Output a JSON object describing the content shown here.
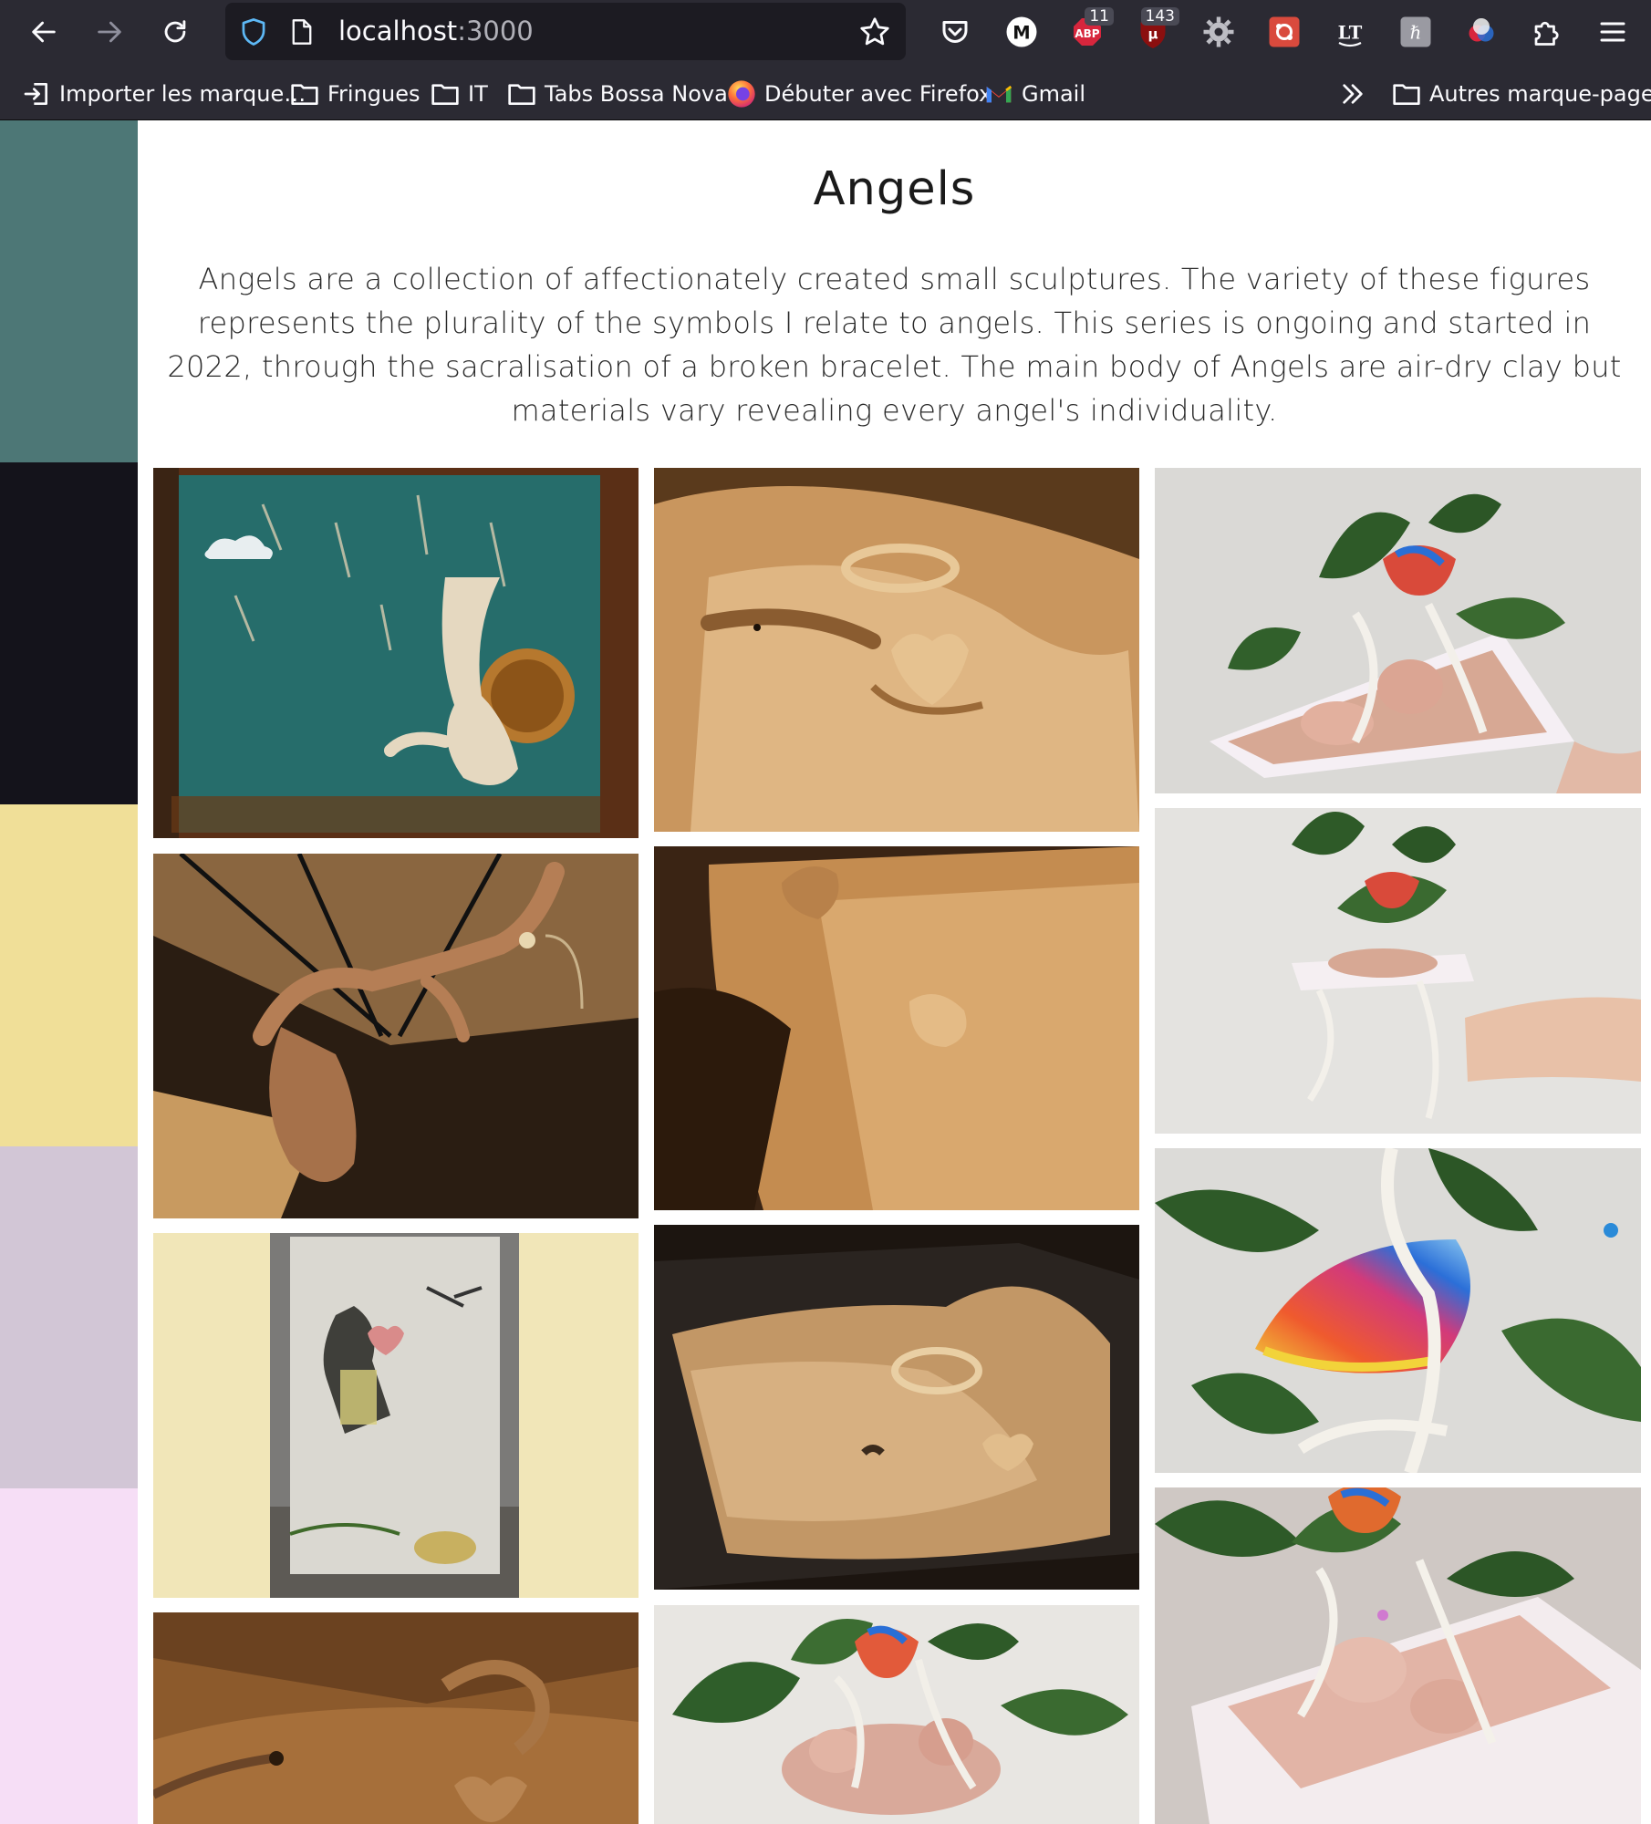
{
  "browser": {
    "url_host": "localhost",
    "url_port": ":3000",
    "extensions": [
      {
        "name": "pocket-icon"
      },
      {
        "name": "m-extension-icon",
        "label": "M"
      },
      {
        "name": "adblock-icon",
        "badge": "11",
        "label": "ABP"
      },
      {
        "name": "ublock-icon",
        "badge": "143"
      },
      {
        "name": "gear-extension-icon"
      },
      {
        "name": "red-square-extension-icon"
      },
      {
        "name": "languagetool-icon",
        "label": "LT"
      },
      {
        "name": "grey-h-extension-icon"
      },
      {
        "name": "color-picker-extension-icon"
      },
      {
        "name": "extensions-puzzle-icon"
      },
      {
        "name": "hamburger-menu-icon"
      }
    ],
    "bookmarks": [
      {
        "label": "Importer les marque…",
        "icon": "import-icon"
      },
      {
        "label": "Fringues",
        "icon": "folder-icon"
      },
      {
        "label": "IT",
        "icon": "folder-icon"
      },
      {
        "label": "Tabs Bossa Nova",
        "icon": "folder-icon"
      },
      {
        "label": "Débuter avec Firefox",
        "icon": "firefox-icon"
      },
      {
        "label": "Gmail",
        "icon": "gmail-icon"
      }
    ],
    "other_bookmarks": "Autres marque-pages"
  },
  "palette": [
    "#4d7776",
    "#14131b",
    "#f0df98",
    "#d2c6d6",
    "#f6def6"
  ],
  "page": {
    "title": "Angels",
    "description": "Angels are a collection of affectionately created small sculptures. The variety of these figures represents the plurality of the symbols I relate to angels. This series is ongoing and started in 2022, through the sacralisation of a broken bracelet. The main body of Angels are air-dry clay but materials vary revealing every angel's individuality."
  },
  "gallery": {
    "columns": [
      [
        {
          "name": "angel-photo-teal-painting"
        },
        {
          "name": "angel-photo-clay-branch"
        },
        {
          "name": "angel-photo-glass-panel"
        },
        {
          "name": "angel-photo-clay-bird-closeup"
        }
      ],
      [
        {
          "name": "angel-photo-felt-halo-heart"
        },
        {
          "name": "angel-photo-felt-clay-pieces"
        },
        {
          "name": "angel-photo-felt-dark-tray"
        },
        {
          "name": "angel-photo-leaves-figures-bottom"
        }
      ],
      [
        {
          "name": "angel-photo-leaves-tray"
        },
        {
          "name": "angel-photo-leaves-held-arm"
        },
        {
          "name": "angel-photo-rainbow-wing"
        },
        {
          "name": "angel-photo-leaves-pink-tray"
        }
      ]
    ]
  }
}
